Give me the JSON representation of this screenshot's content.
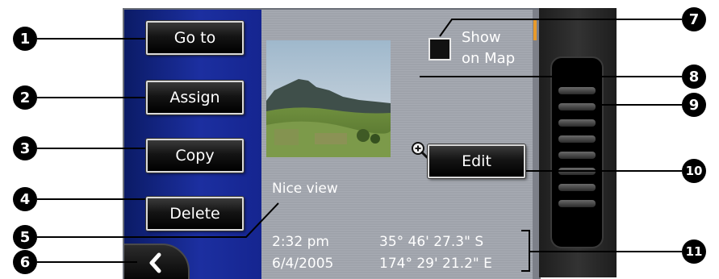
{
  "buttons": {
    "goto": "Go to",
    "assign": "Assign",
    "copy": "Copy",
    "delete": "Delete",
    "edit": "Edit",
    "back_icon": "chevron-left-icon"
  },
  "checkbox": {
    "label_line1": "Show",
    "label_line2": "on Map",
    "checked": false
  },
  "note": "Nice view",
  "details": {
    "time": "2:32 pm",
    "date": "6/4/2005",
    "latitude": "35° 46' 27.3\" S",
    "longitude": "174° 29' 21.2\" E"
  },
  "zoom_icon": "magnifier-plus-icon",
  "scrollbar": {
    "position": 0.0
  },
  "callouts": [
    "1",
    "2",
    "3",
    "4",
    "5",
    "6",
    "7",
    "8",
    "9",
    "10",
    "11"
  ],
  "colors": {
    "panel_blue": "#1c2fa0",
    "screen_grey": "#9fa3ab",
    "scroll_thumb": "#e89a2a"
  }
}
